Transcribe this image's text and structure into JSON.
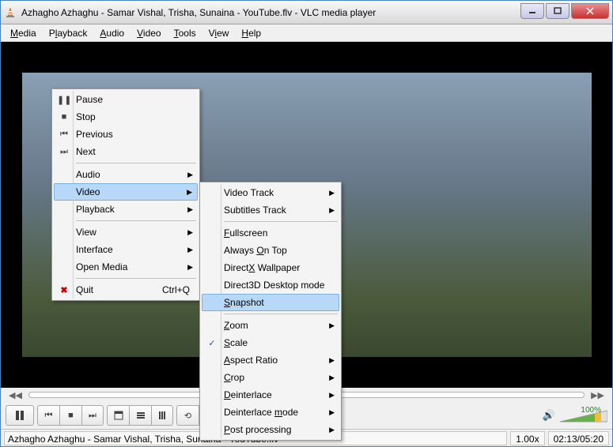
{
  "titlebar": {
    "text": "Azhagho Azhaghu - Samar Vishal, Trisha, Sunaina - YouTube.flv - VLC media player"
  },
  "menubar": [
    "Media",
    "Playback",
    "Audio",
    "Video",
    "Tools",
    "View",
    "Help"
  ],
  "context_menu_1": {
    "items": [
      {
        "label": "Pause"
      },
      {
        "label": "Stop"
      },
      {
        "label": "Previous"
      },
      {
        "label": "Next"
      },
      {
        "sep": true
      },
      {
        "label": "Audio",
        "submenu": true
      },
      {
        "label": "Video",
        "submenu": true,
        "highlight": true
      },
      {
        "label": "Playback",
        "submenu": true
      },
      {
        "sep": true
      },
      {
        "label": "View",
        "submenu": true
      },
      {
        "label": "Interface",
        "submenu": true
      },
      {
        "label": "Open Media",
        "submenu": true
      },
      {
        "sep": true
      },
      {
        "label": "Quit",
        "shortcut": "Ctrl+Q"
      }
    ]
  },
  "context_menu_2": {
    "items": [
      {
        "label": "Video Track",
        "submenu": true
      },
      {
        "label": "Subtitles Track",
        "submenu": true
      },
      {
        "sep": true
      },
      {
        "label": "Fullscreen",
        "u": 0
      },
      {
        "label": "Always On Top",
        "u": 7
      },
      {
        "label": "DirectX Wallpaper",
        "u": 6
      },
      {
        "label": "Direct3D Desktop mode"
      },
      {
        "label": "Snapshot",
        "u": 0,
        "highlight": true
      },
      {
        "sep": true
      },
      {
        "label": "Zoom",
        "u": 0,
        "submenu": true
      },
      {
        "label": "Scale",
        "u": 0,
        "check": true
      },
      {
        "label": "Aspect Ratio",
        "u": 0,
        "submenu": true
      },
      {
        "label": "Crop",
        "u": 0,
        "submenu": true
      },
      {
        "label": "Deinterlace",
        "u": 0,
        "submenu": true
      },
      {
        "label": "Deinterlace mode",
        "u": 12,
        "submenu": true
      },
      {
        "label": "Post processing",
        "u": 0,
        "submenu": true
      }
    ]
  },
  "statusbar": {
    "text": "Azhagho Azhaghu - Samar Vishal, Trisha, Sunaina - YouTube.flv",
    "speed": "1.00x",
    "time": "02:13/05:20"
  },
  "volume": {
    "pct": "100%"
  }
}
